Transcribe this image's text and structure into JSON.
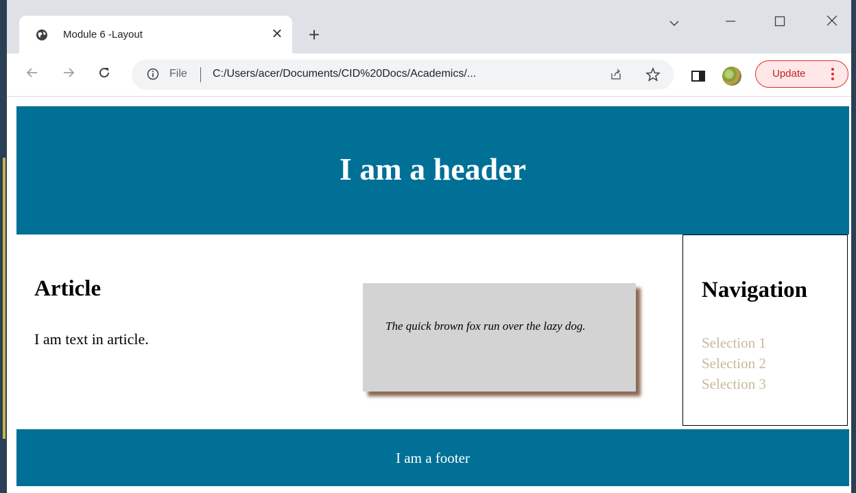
{
  "browser": {
    "tab_title": "Module 6 -Layout",
    "file_label": "File",
    "url": "C:/Users/acer/Documents/CID%20Docs/Academics/...",
    "update_label": "Update",
    "icons": [
      "globe-icon",
      "close-icon",
      "plus-icon",
      "chevron-down-icon",
      "minimize-icon",
      "maximize-icon",
      "window-close-icon",
      "back-arrow-icon",
      "forward-arrow-icon",
      "reload-icon",
      "info-icon",
      "share-icon",
      "star-icon",
      "side-panel-icon",
      "kebab-menu-icon"
    ]
  },
  "page": {
    "header_title": "I am a header",
    "article": {
      "heading": "Article",
      "text": "I am text in article."
    },
    "quote": "The quick brown fox run over the lazy dog.",
    "nav": {
      "heading": "Navigation",
      "items": [
        "Selection 1",
        "Selection 2",
        "Selection 3"
      ]
    },
    "footer": "I am a footer"
  },
  "colors": {
    "header_bg": "#007096",
    "footer_bg": "#007096",
    "nav_link": "#c9b99a",
    "quote_bg": "#d3d3d3",
    "quote_shadow": "#8a6a55",
    "update_accent": "#d93025"
  }
}
